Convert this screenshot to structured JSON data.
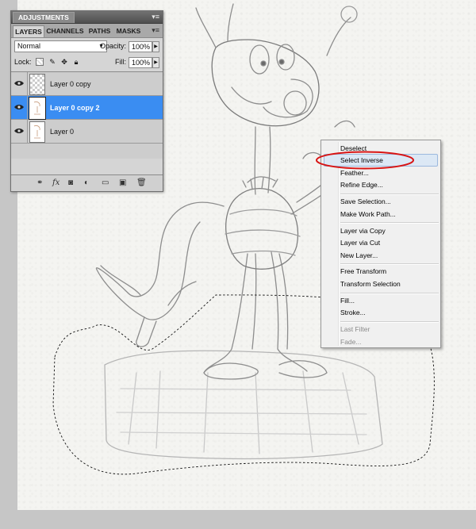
{
  "panel": {
    "adjustments_tab": "ADJUSTMENTS",
    "tabs": [
      "LAYERS",
      "CHANNELS",
      "PATHS",
      "MASKS"
    ],
    "blend_mode": "Normal",
    "opacity_label": "Opacity:",
    "opacity_value": "100%",
    "lock_label": "Lock:",
    "fill_label": "Fill:",
    "fill_value": "100%",
    "layers": [
      {
        "name": "Layer 0 copy",
        "selected": false,
        "visible": true
      },
      {
        "name": "Layer 0 copy 2",
        "selected": true,
        "visible": true
      },
      {
        "name": "Layer 0",
        "selected": false,
        "visible": true
      }
    ],
    "footer_icons": [
      "link-layers-icon",
      "fx-icon",
      "layer-mask-icon",
      "adjustment-layer-icon",
      "group-folder-icon",
      "new-layer-icon",
      "trash-icon"
    ],
    "selection_color": "#3a8df2"
  },
  "context_menu": {
    "items": [
      {
        "label": "Deselect",
        "disabled": false
      },
      {
        "label": "Select Inverse",
        "disabled": false,
        "highlighted": true,
        "circled": true
      },
      {
        "label": "Feather...",
        "disabled": false
      },
      {
        "label": "Refine Edge...",
        "disabled": false
      },
      {
        "label": "Save Selection...",
        "disabled": false
      },
      {
        "label": "Make Work Path...",
        "disabled": false
      },
      {
        "label": "Layer via Copy",
        "disabled": false
      },
      {
        "label": "Layer via Cut",
        "disabled": false
      },
      {
        "label": "New Layer...",
        "disabled": false
      },
      {
        "label": "Free Transform",
        "disabled": false
      },
      {
        "label": "Transform Selection",
        "disabled": false
      },
      {
        "label": "Fill...",
        "disabled": false
      },
      {
        "label": "Stroke...",
        "disabled": false
      },
      {
        "label": "Last Filter",
        "disabled": true
      },
      {
        "label": "Fade...",
        "disabled": true
      }
    ],
    "annotation_color": "#d81414"
  }
}
